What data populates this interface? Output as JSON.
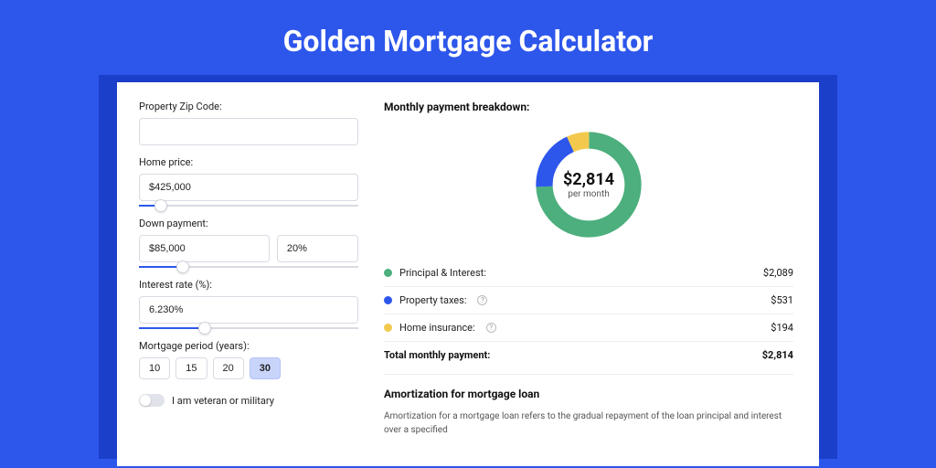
{
  "page": {
    "title": "Golden Mortgage Calculator"
  },
  "inputs": {
    "zip": {
      "label": "Property Zip Code:",
      "value": ""
    },
    "home_price": {
      "label": "Home price:",
      "value": "$425,000"
    },
    "down_payment": {
      "label": "Down payment:",
      "amount": "$85,000",
      "percent": "20%"
    },
    "interest_rate": {
      "label": "Interest rate (%):",
      "value": "6.230%"
    },
    "period": {
      "label": "Mortgage period (years):",
      "options": [
        "10",
        "15",
        "20",
        "30"
      ],
      "selected": "30"
    },
    "veteran": {
      "label": "I am veteran or military"
    }
  },
  "breakdown": {
    "heading": "Monthly payment breakdown:",
    "center_amount": "$2,814",
    "center_sub": "per month",
    "items": [
      {
        "label": "Principal & Interest:",
        "value": "$2,089"
      },
      {
        "label": "Property taxes:",
        "value": "$531"
      },
      {
        "label": "Home insurance:",
        "value": "$194"
      }
    ],
    "total_label": "Total monthly payment:",
    "total_value": "$2,814"
  },
  "amortization": {
    "title": "Amortization for mortgage loan",
    "text": "Amortization for a mortgage loan refers to the gradual repayment of the loan principal and interest over a specified"
  },
  "chart_data": {
    "type": "pie",
    "title": "Monthly payment breakdown",
    "series": [
      {
        "name": "Principal & Interest",
        "value": 2089,
        "color": "#4caf7d"
      },
      {
        "name": "Property taxes",
        "value": 531,
        "color": "#2d56eb"
      },
      {
        "name": "Home insurance",
        "value": 194,
        "color": "#f2c94c"
      }
    ],
    "total": 2814,
    "center_label": "$2,814 per month"
  }
}
